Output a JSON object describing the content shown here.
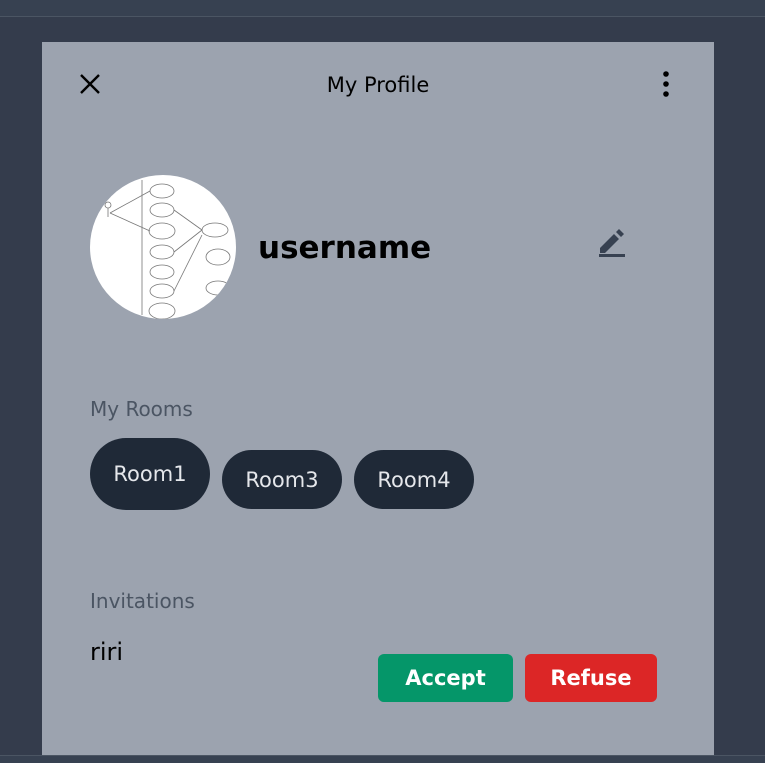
{
  "header": {
    "title": "My Profile",
    "close_icon": "close-icon",
    "menu_icon": "more-vertical-icon"
  },
  "profile": {
    "username": "username",
    "edit_icon": "pencil-icon"
  },
  "rooms": {
    "heading": "My Rooms",
    "items": [
      "Room1",
      "Room3",
      "Room4"
    ]
  },
  "invitations": {
    "heading": "Invitations",
    "items": [
      {
        "from": "riri",
        "accept_label": "Accept",
        "refuse_label": "Refuse"
      }
    ]
  },
  "colors": {
    "accept": "#059669",
    "refuse": "#dc2626",
    "room_bg": "#1f2937",
    "panel": "#9ca3af"
  }
}
